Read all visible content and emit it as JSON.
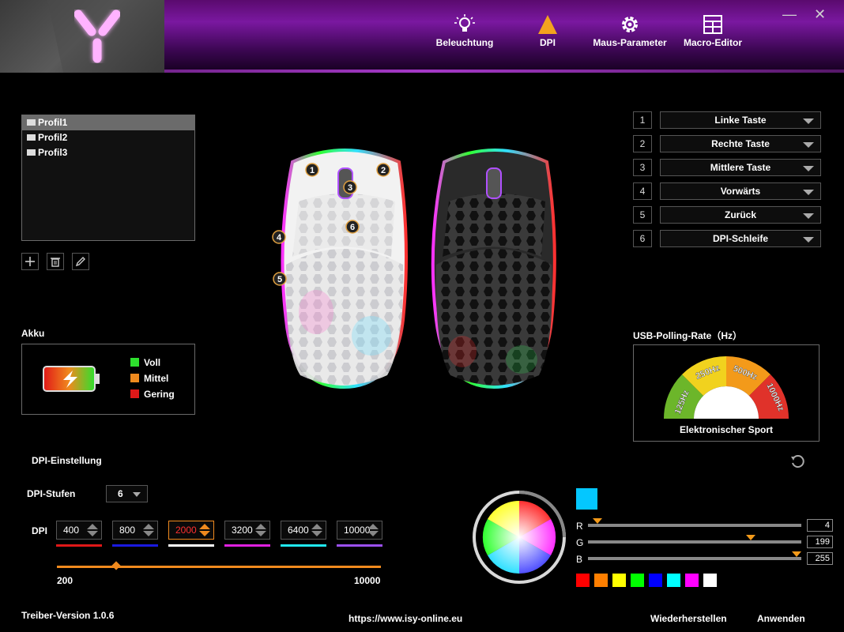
{
  "nav": {
    "items": [
      {
        "label": "Beleuchtung",
        "icon": "lightbulb-icon"
      },
      {
        "label": "DPI",
        "icon": "triangle-icon"
      },
      {
        "label": "Maus-Parameter",
        "icon": "gear-icon"
      },
      {
        "label": "Macro-Editor",
        "icon": "grid-icon"
      }
    ],
    "minimize": "—",
    "close": "✕"
  },
  "profiles": [
    "Profil1",
    "Profil2",
    "Profil3"
  ],
  "profile_actions": {
    "add": "+",
    "delete": "🗑",
    "edit": "✎"
  },
  "akku": {
    "title": "Akku",
    "legend": [
      {
        "label": "Voll",
        "color": "#2ee02e"
      },
      {
        "label": "Mittel",
        "color": "#f08a1e"
      },
      {
        "label": "Gering",
        "color": "#e01818"
      }
    ]
  },
  "mouse_markers": [
    "1",
    "2",
    "3",
    "4",
    "5",
    "6"
  ],
  "button_mapping": [
    {
      "num": "1",
      "value": "Linke Taste"
    },
    {
      "num": "2",
      "value": "Rechte Taste"
    },
    {
      "num": "3",
      "value": "Mittlere Taste"
    },
    {
      "num": "4",
      "value": "Vorwärts"
    },
    {
      "num": "5",
      "value": "Zurück"
    },
    {
      "num": "6",
      "value": "DPI-Schleife"
    }
  ],
  "polling": {
    "title": "USB-Polling-Rate（Hz）",
    "rates": [
      "125Hz",
      "250Hz",
      "500Hz",
      "1000Hz"
    ],
    "mode": "Elektronischer Sport"
  },
  "dpi": {
    "section_title": "DPI-Einstellung",
    "stufen_label": "DPI-Stufen",
    "stufen_value": "6",
    "dpi_label": "DPI",
    "levels": [
      {
        "value": "400",
        "color": "#e01818",
        "active": false
      },
      {
        "value": "800",
        "color": "#1a1ae0",
        "active": false
      },
      {
        "value": "2000",
        "color": "#ffffff",
        "active": true
      },
      {
        "value": "3200",
        "color": "#e020e0",
        "active": false
      },
      {
        "value": "6400",
        "color": "#20e8f0",
        "active": false
      },
      {
        "value": "10000",
        "color": "#9b50f0",
        "active": false
      }
    ],
    "slider_min": "200",
    "slider_max": "10000",
    "slider_value": 2000
  },
  "color": {
    "preview": "#04c7ff",
    "r_label": "R",
    "g_label": "G",
    "b_label": "B",
    "r": "4",
    "g": "199",
    "b": "255",
    "swatches": [
      "#ff0000",
      "#ff7f00",
      "#ffff00",
      "#00ff00",
      "#0000ff",
      "#00ffff",
      "#ff00ff",
      "#ffffff"
    ]
  },
  "footer": {
    "version": "Treiber-Version 1.0.6",
    "url": "https://www.isy-online.eu",
    "restore": "Wiederherstellen",
    "apply": "Anwenden"
  }
}
